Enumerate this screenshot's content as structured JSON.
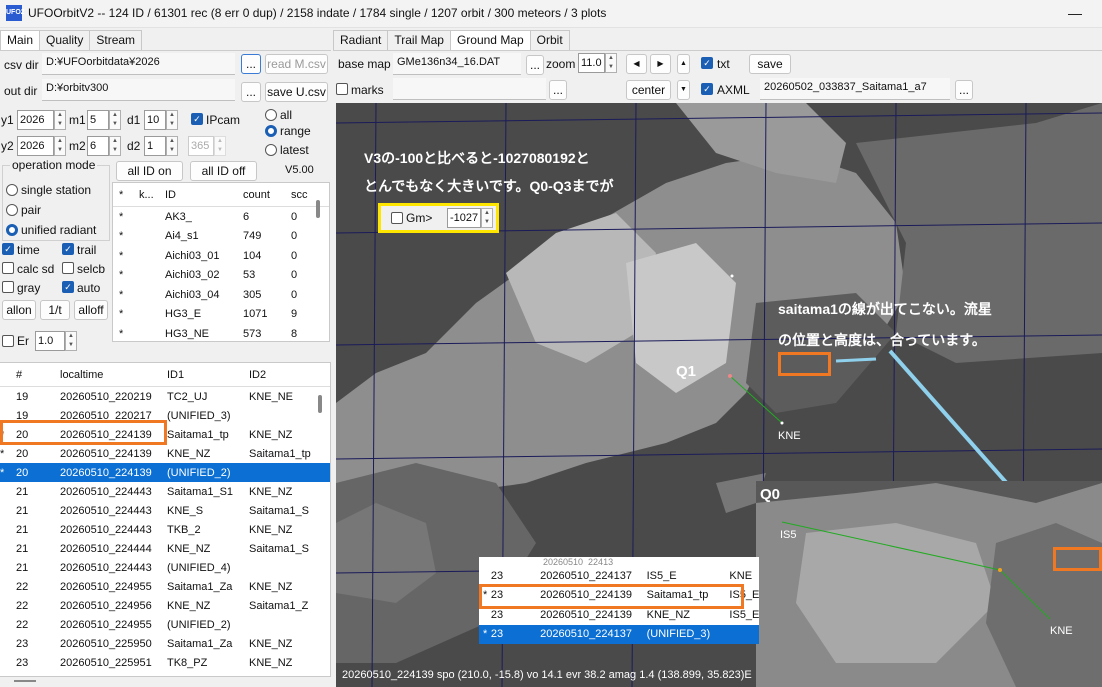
{
  "window": {
    "title": "UFOOrbitV2 -- 124 ID / 61301 rec (8 err 0 dup) / 2158 indate / 1784 single / 1207 orbit / 300 meteors / 3 plots",
    "icon_text": "UFO2",
    "minimize": "—"
  },
  "left_tabs": [
    "Main",
    "Quality",
    "Stream"
  ],
  "right_tabs": [
    "Radiant",
    "Trail Map",
    "Ground Map",
    "Orbit"
  ],
  "csv_dir": {
    "label": "csv dir",
    "value": "D:¥UFOorbitdata¥2026",
    "browse": "...",
    "read_button": "read M.csv"
  },
  "out_dir": {
    "label": "out dir",
    "value": "D:¥orbitv300",
    "browse": "...",
    "save_button": "save U.csv"
  },
  "date": {
    "y1": "y1",
    "y1v": "2026",
    "m1": "m1",
    "m1v": "5",
    "d1": "d1",
    "d1v": "10",
    "y2": "y2",
    "y2v": "2026",
    "m2": "m2",
    "m2v": "6",
    "d2": "d2",
    "d2v": "1",
    "doy": "365",
    "ipcam": "IPcam"
  },
  "range_opts": {
    "all": "all",
    "range": "range",
    "latest": "latest"
  },
  "opmode": {
    "title": "operation mode",
    "single": "single station",
    "pair": "pair",
    "unified": "unified radiant"
  },
  "checks": {
    "time": "time",
    "trail": "trail",
    "calcsd": "calc sd",
    "selcb": "selcb",
    "gray": "gray",
    "auto": "auto",
    "er": "Er",
    "er_value": "1.0"
  },
  "buttons": {
    "allon": "allon",
    "onet": "1/t",
    "alloff": "alloff",
    "all_id_on": "all ID on",
    "all_id_off": "all ID off",
    "version": "V5.00"
  },
  "id_table": {
    "headers": [
      "*",
      "k...",
      "ID",
      "count",
      "scc"
    ],
    "rows": [
      [
        "*",
        "",
        "AK3_",
        "6",
        "0"
      ],
      [
        "*",
        "",
        "Ai4_s1",
        "749",
        "0"
      ],
      [
        "*",
        "",
        "Aichi03_01",
        "104",
        "0"
      ],
      [
        "*",
        "",
        "Aichi03_02",
        "53",
        "0"
      ],
      [
        "*",
        "",
        "Aichi03_04",
        "305",
        "0"
      ],
      [
        "*",
        "",
        "HG3_E",
        "1071",
        "9"
      ],
      [
        "*",
        "",
        "HG3_NE",
        "573",
        "8"
      ]
    ]
  },
  "meteor_table": {
    "headers": [
      "",
      "#",
      "localtime",
      "ID1",
      "ID2"
    ],
    "rows": [
      [
        "",
        "19",
        "20260510_220219",
        "TC2_UJ",
        "KNE_NE"
      ],
      [
        "",
        "19",
        "20260510_220217",
        "(UNIFIED_3)",
        ""
      ],
      [
        "*",
        "20",
        "20260510_224139",
        "Saitama1_tp",
        "KNE_NZ"
      ],
      [
        "*",
        "20",
        "20260510_224139",
        "KNE_NZ",
        "Saitama1_tp"
      ],
      [
        "*",
        "20",
        "20260510_224139",
        "(UNIFIED_2)",
        ""
      ],
      [
        "",
        "21",
        "20260510_224443",
        "Saitama1_S1",
        "KNE_NZ"
      ],
      [
        "",
        "21",
        "20260510_224443",
        "KNE_S",
        "Saitama1_S"
      ],
      [
        "",
        "21",
        "20260510_224443",
        "TKB_2",
        "KNE_NZ"
      ],
      [
        "",
        "21",
        "20260510_224444",
        "KNE_NZ",
        "Saitama1_S"
      ],
      [
        "",
        "21",
        "20260510_224443",
        "(UNIFIED_4)",
        ""
      ],
      [
        "",
        "22",
        "20260510_224955",
        "Saitama1_Za",
        "KNE_NZ"
      ],
      [
        "",
        "22",
        "20260510_224956",
        "KNE_NZ",
        "Saitama1_Z"
      ],
      [
        "",
        "22",
        "20260510_224955",
        "(UNIFIED_2)",
        ""
      ],
      [
        "",
        "23",
        "20260510_225950",
        "Saitama1_Za",
        "KNE_NZ"
      ],
      [
        "",
        "23",
        "20260510_225951",
        "TK8_PZ",
        "KNE_NZ"
      ]
    ]
  },
  "ground": {
    "base_label": "base map",
    "base_value": "GMe136n34_16.DAT",
    "browse": "...",
    "zoom_label": "zoom",
    "zoom_value": "11.0",
    "save": "save",
    "txt": "txt",
    "marks": "marks",
    "marks_browse": "...",
    "center": "center",
    "axml": "AXML",
    "axml_value": "20260502_033837_Saitama1_a7",
    "axml_browse": "..."
  },
  "overlay": {
    "note1_line1": "V3の-100と比べると-1027080192と",
    "note1_line2": "とんでもなく大きいです。Q0-Q3までが",
    "gm_label": "Gm>",
    "gm_value": "-1027",
    "note2_line1": "saitama1の線が出てこない。流星",
    "note2_line2": "の位置と高度は、合っています。",
    "q1": "Q1",
    "q0": "Q0",
    "kne": "KNE",
    "is5": "IS5"
  },
  "inset_table": {
    "rows": [
      [
        "",
        "23",
        "20260510_224137",
        "IS5_E",
        "KNE"
      ],
      [
        "*",
        "23",
        "20260510_224139",
        "Saitama1_tp",
        "IS5_E"
      ],
      [
        "",
        "23",
        "20260510_224139",
        "KNE_NZ",
        "IS5_E"
      ],
      [
        "*",
        "23",
        "20260510_224137",
        "(UNIFIED_3)",
        ""
      ]
    ],
    "partial_top": "20260510_22413"
  },
  "status": "20260510_224139  spo (210.0, -15.8) vo 14.1 evr 38.2 amag 1.4  (138.899, 35.823)E"
}
